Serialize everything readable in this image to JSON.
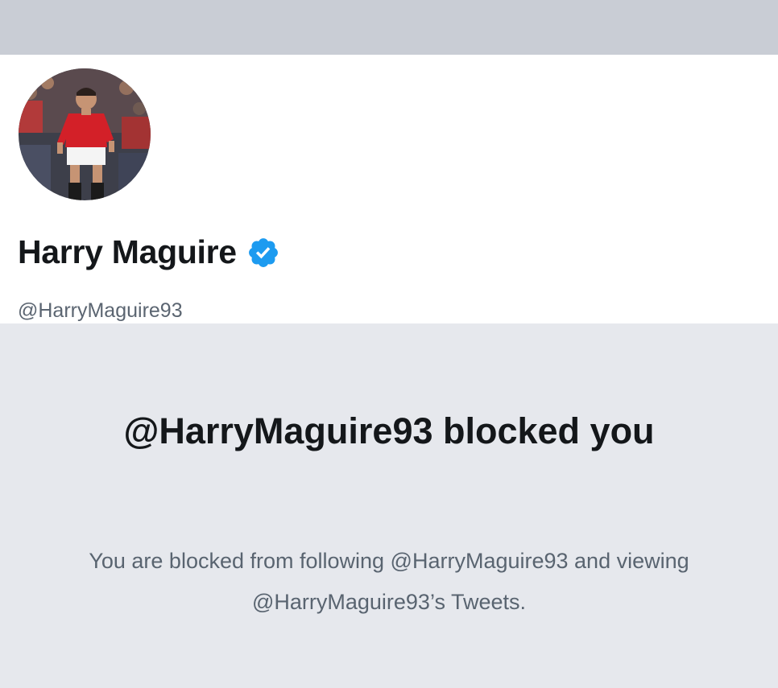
{
  "profile": {
    "display_name": "Harry Maguire",
    "handle": "@HarryMaguire93",
    "verified": true,
    "verified_badge_color": "#1d9bf0",
    "avatar_icon": "profile-photo"
  },
  "blocked_notice": {
    "title": "@HarryMaguire93 blocked you",
    "description": "You are blocked from following @HarryMaguire93 and viewing @HarryMaguire93’s Tweets."
  },
  "colors": {
    "banner": "#c9cdd5",
    "panel": "#e6e8ed",
    "text_primary": "#14171a",
    "text_secondary": "#5b6571"
  }
}
